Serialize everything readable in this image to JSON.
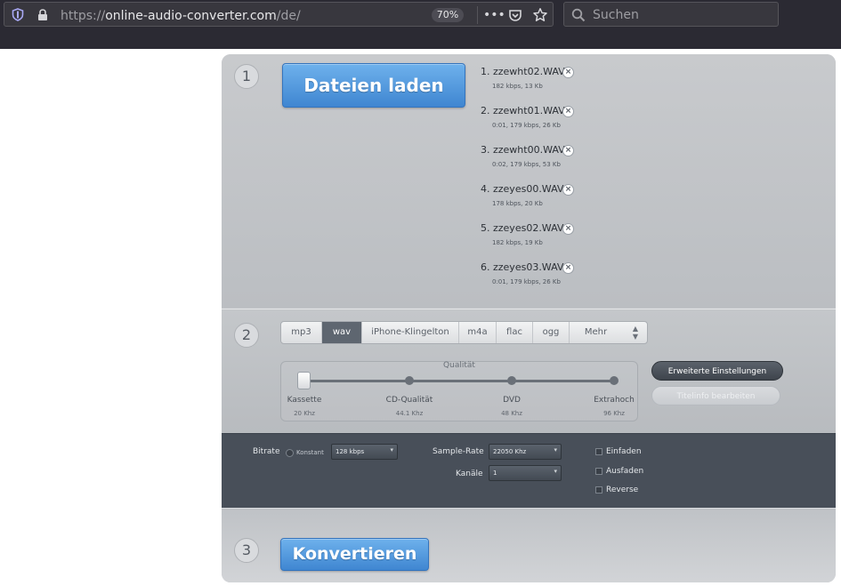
{
  "browser": {
    "url_prefix": "https://",
    "url_host": "online-audio-converter.com",
    "url_path": "/de/",
    "zoom": "70%",
    "search_placeholder": "Suchen",
    "more_glyph": "•••"
  },
  "step1": {
    "number": "1",
    "upload_label": "Dateien laden",
    "files": [
      {
        "name": "1. zzewht02.WAV",
        "meta": "182 kbps, 13 Kb"
      },
      {
        "name": "2. zzewht01.WAV",
        "meta": "0:01, 179 kbps, 26 Kb"
      },
      {
        "name": "3. zzewht00.WAV",
        "meta": "0:02, 179 kbps, 53 Kb"
      },
      {
        "name": "4. zzeyes00.WAV",
        "meta": "178 kbps, 20 Kb"
      },
      {
        "name": "5. zzeyes02.WAV",
        "meta": "182 kbps, 19 Kb"
      },
      {
        "name": "6. zzeyes03.WAV",
        "meta": "0:01, 179 kbps, 26 Kb"
      }
    ]
  },
  "step2": {
    "number": "2",
    "formats": [
      "mp3",
      "wav",
      "iPhone-Klingelton",
      "m4a",
      "flac",
      "ogg",
      "Mehr"
    ],
    "active_format": "wav",
    "quality": {
      "title": "Qualität",
      "level": 0,
      "marks": [
        {
          "label": "Kassette",
          "sub": "20 Khz"
        },
        {
          "label": "CD-Qualität",
          "sub": "44.1 Khz"
        },
        {
          "label": "DVD",
          "sub": "48 Khz"
        },
        {
          "label": "Extrahoch",
          "sub": "96 Khz"
        }
      ]
    },
    "advanced_label": "Erweiterte Einstellungen",
    "titleinfo_label": "Titelinfo bearbeiten"
  },
  "advanced": {
    "bitrate_label": "Bitrate",
    "konstant_label": "Konstant",
    "bitrate_value": "128 kbps",
    "samplerate_label": "Sample-Rate",
    "samplerate_value": "22050 Khz",
    "channels_label": "Kanäle",
    "channels_value": "1",
    "fadein_label": "Einfaden",
    "fadeout_label": "Ausfaden",
    "reverse_label": "Reverse"
  },
  "step3": {
    "number": "3",
    "convert_label": "Konvertieren"
  }
}
